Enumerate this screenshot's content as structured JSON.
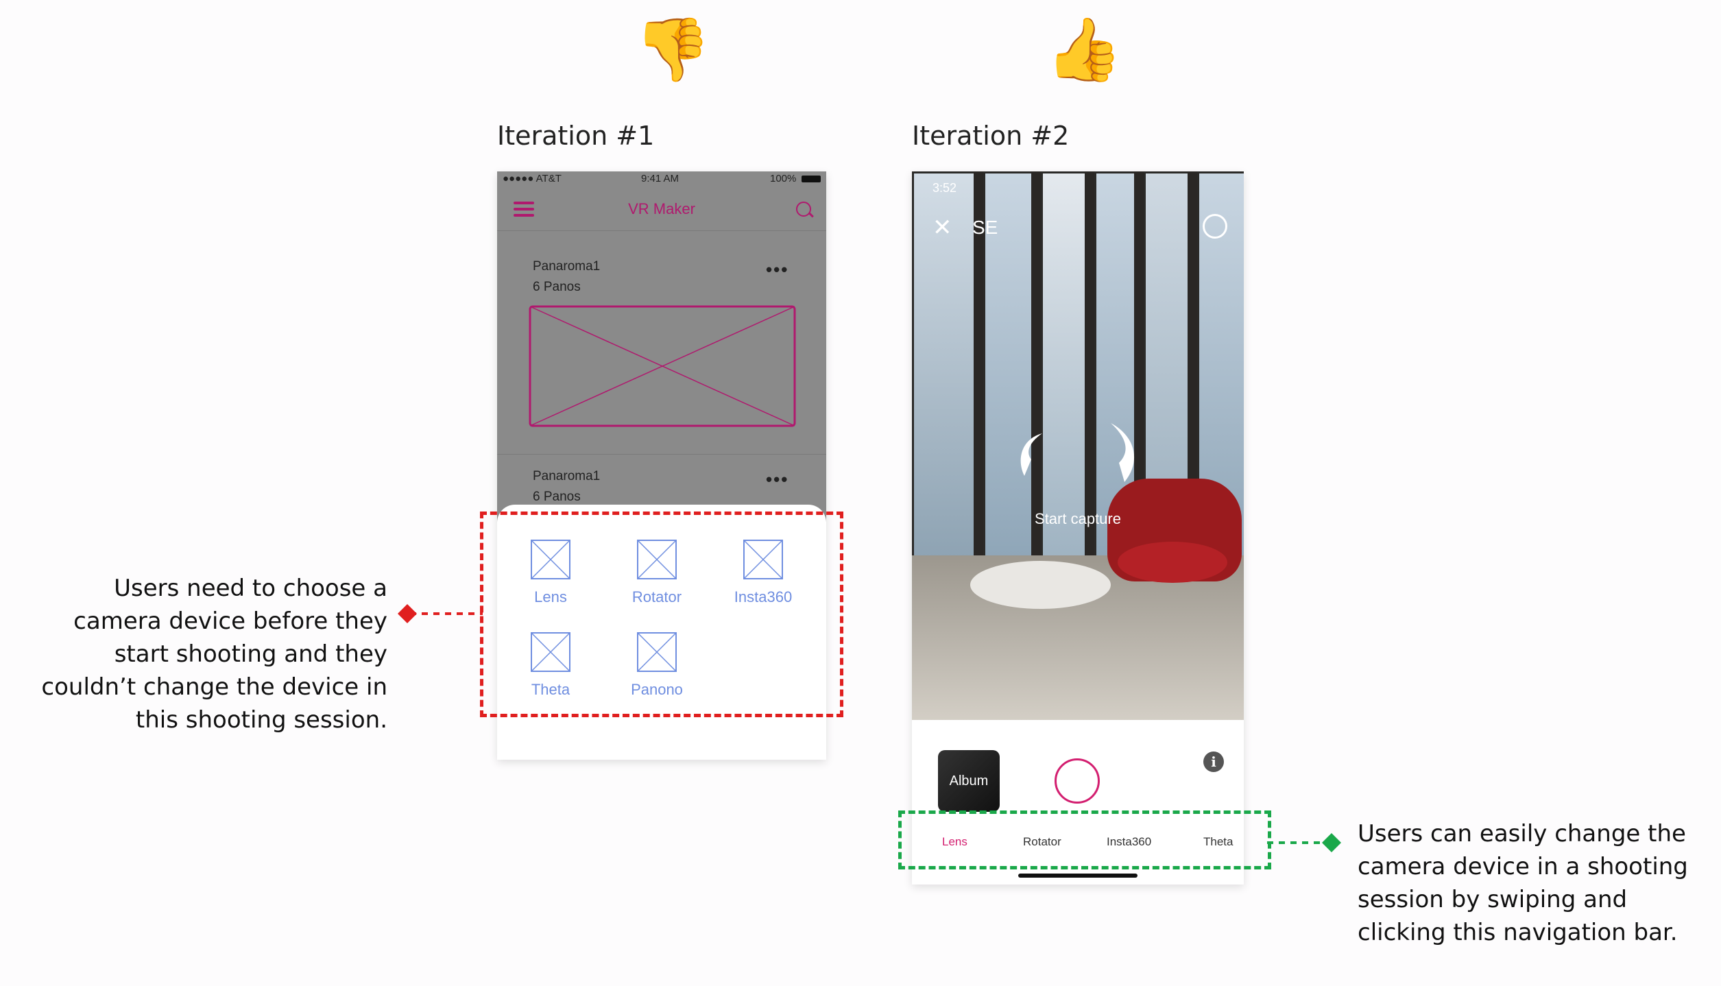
{
  "emojis": {
    "thumbs_down": "👎",
    "thumbs_up": "👍"
  },
  "iterations": [
    {
      "title": "Iteration #1"
    },
    {
      "title": "Iteration #2"
    }
  ],
  "phone1": {
    "status": {
      "carrier": "●●●●● AT&T",
      "time": "9:41 AM",
      "battery": "100%"
    },
    "nav_title": "VR Maker",
    "panoramas": [
      {
        "name": "Panaroma1",
        "count": "6 Panos"
      },
      {
        "name": "Panaroma1",
        "count": "6 Panos"
      }
    ],
    "devices": [
      "Lens",
      "Rotator",
      "Insta360",
      "Theta",
      "Panono"
    ]
  },
  "phone2": {
    "status_time": "3:52",
    "close": "✕",
    "mode": "SE",
    "start_capture": "Start capture",
    "album": "Album",
    "info": "i",
    "tabs": [
      "Lens",
      "Rotator",
      "Insta360",
      "Theta"
    ],
    "active_tab": "Lens"
  },
  "annotations": {
    "left_note": [
      "Users need to choose a",
      "camera device before they",
      "start shooting and they",
      "couldn’t change the device in",
      "this shooting session."
    ],
    "right_note": [
      "Users can easily change the",
      "camera device in a shooting",
      "session by swiping and",
      "clicking this navigation bar."
    ]
  },
  "colors": {
    "accent": "#d31f70",
    "red_marker": "#e01f1f",
    "green_marker": "#1aa84a",
    "device_icon": "#6f8ee0"
  }
}
